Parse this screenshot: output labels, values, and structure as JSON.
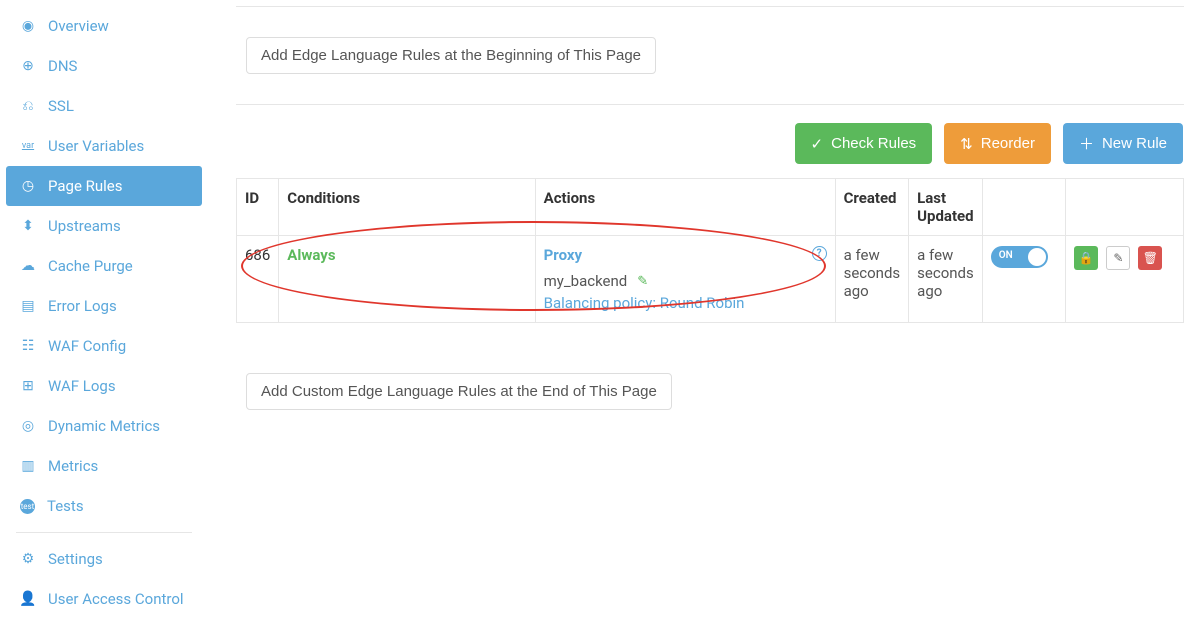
{
  "sidebar": {
    "items": [
      {
        "label": "Overview",
        "icon": "◉"
      },
      {
        "label": "DNS",
        "icon": "⊕"
      },
      {
        "label": "SSL",
        "icon": "⎌"
      },
      {
        "label": "User Variables",
        "icon": "var"
      },
      {
        "label": "Page Rules",
        "icon": "◷"
      },
      {
        "label": "Upstreams",
        "icon": "⬍"
      },
      {
        "label": "Cache Purge",
        "icon": "☁"
      },
      {
        "label": "Error Logs",
        "icon": "▤"
      },
      {
        "label": "WAF Config",
        "icon": "☷"
      },
      {
        "label": "WAF Logs",
        "icon": "⊞"
      },
      {
        "label": "Dynamic Metrics",
        "icon": "◎"
      },
      {
        "label": "Metrics",
        "icon": "▥"
      },
      {
        "label": "Tests",
        "icon": "test"
      }
    ],
    "settings_label": "Settings",
    "uac_label": "User Access Control"
  },
  "buttons": {
    "add_top": "Add Edge Language Rules at the Beginning of This Page",
    "add_bottom": "Add Custom Edge Language Rules at the End of This Page",
    "check_rules": "Check Rules",
    "reorder": "Reorder",
    "new_rule": "New Rule"
  },
  "table": {
    "headers": {
      "id": "ID",
      "conditions": "Conditions",
      "actions": "Actions",
      "created": "Created",
      "updated": "Last Updated"
    },
    "rows": [
      {
        "id": "686",
        "condition": "Always",
        "action_title": "Proxy",
        "backend": "my_backend",
        "policy": "Balancing policy: Round Robin",
        "created": "a few seconds ago",
        "updated": "a few seconds ago",
        "toggle_label": "ON"
      }
    ]
  }
}
